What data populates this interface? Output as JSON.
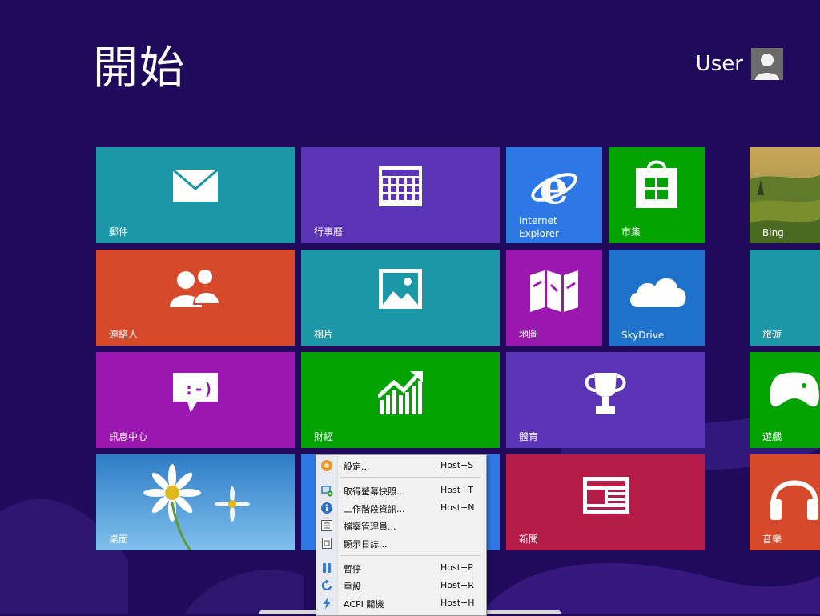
{
  "screen": {
    "title": "開始"
  },
  "user": {
    "name": "User",
    "avatar_icon": "user-avatar-icon"
  },
  "colors": {
    "background": "#1f0a5c",
    "teal": "#1b97a7",
    "purple": "#5b33b5",
    "blue": "#2d78e4",
    "green": "#00a300",
    "orange": "#d6492b",
    "magenta": "#9a17b0",
    "crimson": "#b51d48",
    "sky_blue": "#1e72c9"
  },
  "tiles": {
    "mail": {
      "label": "郵件",
      "icon": "mail-icon"
    },
    "calendar": {
      "label": "行事曆",
      "icon": "calendar-icon"
    },
    "ie": {
      "label_line1": "Internet",
      "label_line2": "Explorer",
      "icon": "internet-explorer-icon"
    },
    "store": {
      "label": "市集",
      "icon": "store-icon"
    },
    "bing": {
      "label": "Bing",
      "icon": "bing-landscape-image"
    },
    "people": {
      "label": "連絡人",
      "icon": "people-icon"
    },
    "photos": {
      "label": "相片",
      "icon": "photos-icon"
    },
    "maps": {
      "label": "地圖",
      "icon": "maps-icon"
    },
    "skydrive": {
      "label": "SkyDrive",
      "icon": "cloud-icon"
    },
    "travel": {
      "label": "旅遊",
      "icon": "travel-icon"
    },
    "messaging": {
      "label": "訊息中心",
      "icon": "messaging-icon",
      "emoticon": ":-)"
    },
    "finance": {
      "label": "財經",
      "icon": "finance-chart-icon"
    },
    "sports": {
      "label": "體育",
      "icon": "trophy-icon"
    },
    "games": {
      "label": "遊戲",
      "icon": "xbox-controller-icon"
    },
    "desktop": {
      "label": "桌面",
      "icon": "daisy-wallpaper-image"
    },
    "news": {
      "label": "新聞",
      "icon": "news-icon"
    },
    "music": {
      "label": "音樂",
      "icon": "headphones-icon"
    }
  },
  "context_menu": {
    "items": [
      {
        "label": "設定...",
        "shortcut": "Host+S",
        "icon": "settings-icon"
      },
      {
        "label": "取得螢幕快照...",
        "shortcut": "Host+T",
        "icon": "screenshot-icon"
      },
      {
        "label": "工作階段資訊...",
        "shortcut": "Host+N",
        "icon": "info-icon"
      },
      {
        "label": "檔案管理員...",
        "shortcut": "",
        "icon": "file-manager-icon"
      },
      {
        "label": "顯示日誌...",
        "shortcut": "",
        "icon": "log-icon"
      },
      {
        "label": "暫停",
        "shortcut": "Host+P",
        "icon": "pause-icon"
      },
      {
        "label": "重設",
        "shortcut": "Host+R",
        "icon": "reset-icon"
      },
      {
        "label": "ACPI 關機",
        "shortcut": "Host+H",
        "icon": "acpi-shutdown-icon"
      }
    ]
  }
}
